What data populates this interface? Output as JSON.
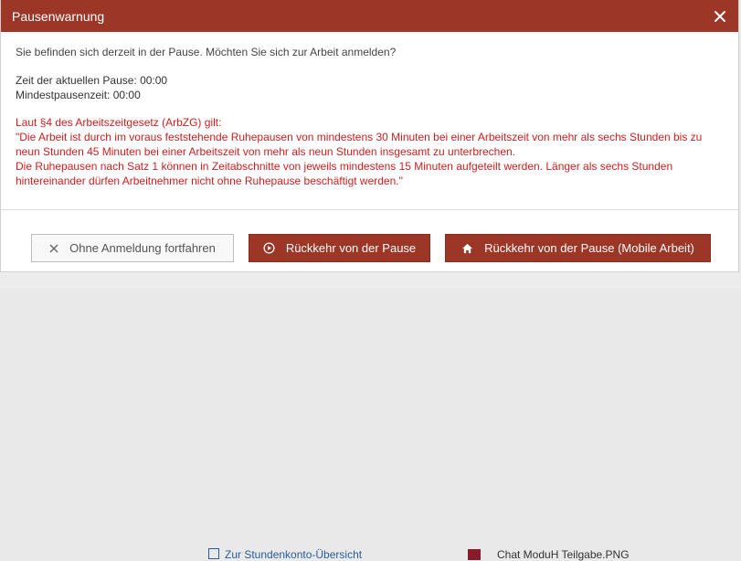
{
  "dialog": {
    "title": "Pausenwarnung",
    "intro": "Sie befinden sich derzeit in der Pause. Möchten Sie sich zur Arbeit anmelden?",
    "current_pause": "Zeit der aktuellen Pause: 00:00",
    "min_pause": "Mindestpausenzeit: 00:00",
    "law_heading": "Laut §4 des Arbeitszeitgesetz (ArbZG) gilt:",
    "law_text_1": "\"Die Arbeit ist durch im voraus feststehende Ruhepausen von mindestens 30 Minuten bei einer Arbeitszeit von mehr als sechs Stunden bis zu neun Stunden 45 Minuten bei einer Arbeitszeit von mehr als neun Stunden insgesamt zu unterbrechen.",
    "law_text_2": "Die Ruhepausen nach Satz 1 können in Zeitabschnitte von jeweils mindestens 15 Minuten aufgeteilt werden. Länger als sechs Stunden hintereinander dürfen Arbeitnehmer nicht ohne Ruhepause beschäftigt werden.\"",
    "buttons": {
      "continue_without_login": "Ohne Anmeldung fortfahren",
      "return_from_pause": "Rückkehr von der Pause",
      "return_mobile": "Rückkehr von der Pause (Mobile Arbeit)"
    }
  },
  "background": {
    "link_text": "Zur Stundenkonto-Übersicht",
    "file_text": "Chat ModuH Teilgabe.PNG"
  },
  "colors": {
    "accent": "#9c3626",
    "law_text": "#cc2020"
  },
  "icons": {
    "close": "close-icon",
    "continue": "x-icon",
    "return_from_pause": "play-circle-icon",
    "return_mobile": "home-icon"
  }
}
